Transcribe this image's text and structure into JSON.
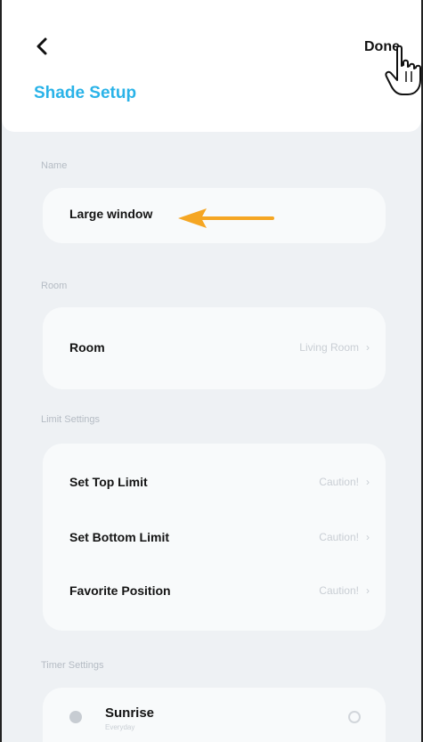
{
  "header": {
    "done_label": "Done",
    "title": "Shade Setup"
  },
  "sections": {
    "name": {
      "label": "Name",
      "value": "Large window"
    },
    "room": {
      "label": "Room",
      "row_label": "Room",
      "row_value": "Living Room"
    },
    "limit_settings": {
      "label": "Limit Settings",
      "rows": [
        {
          "label": "Set Top Limit",
          "value": "Caution!"
        },
        {
          "label": "Set Bottom Limit",
          "value": "Caution!"
        },
        {
          "label": "Favorite Position",
          "value": "Caution!"
        }
      ]
    },
    "timer_settings": {
      "label": "Timer Settings",
      "rows": [
        {
          "label": "Sunrise",
          "sublabel": "Everyday"
        }
      ]
    }
  },
  "colors": {
    "accent": "#2ab3e8",
    "arrow": "#f5a623"
  }
}
